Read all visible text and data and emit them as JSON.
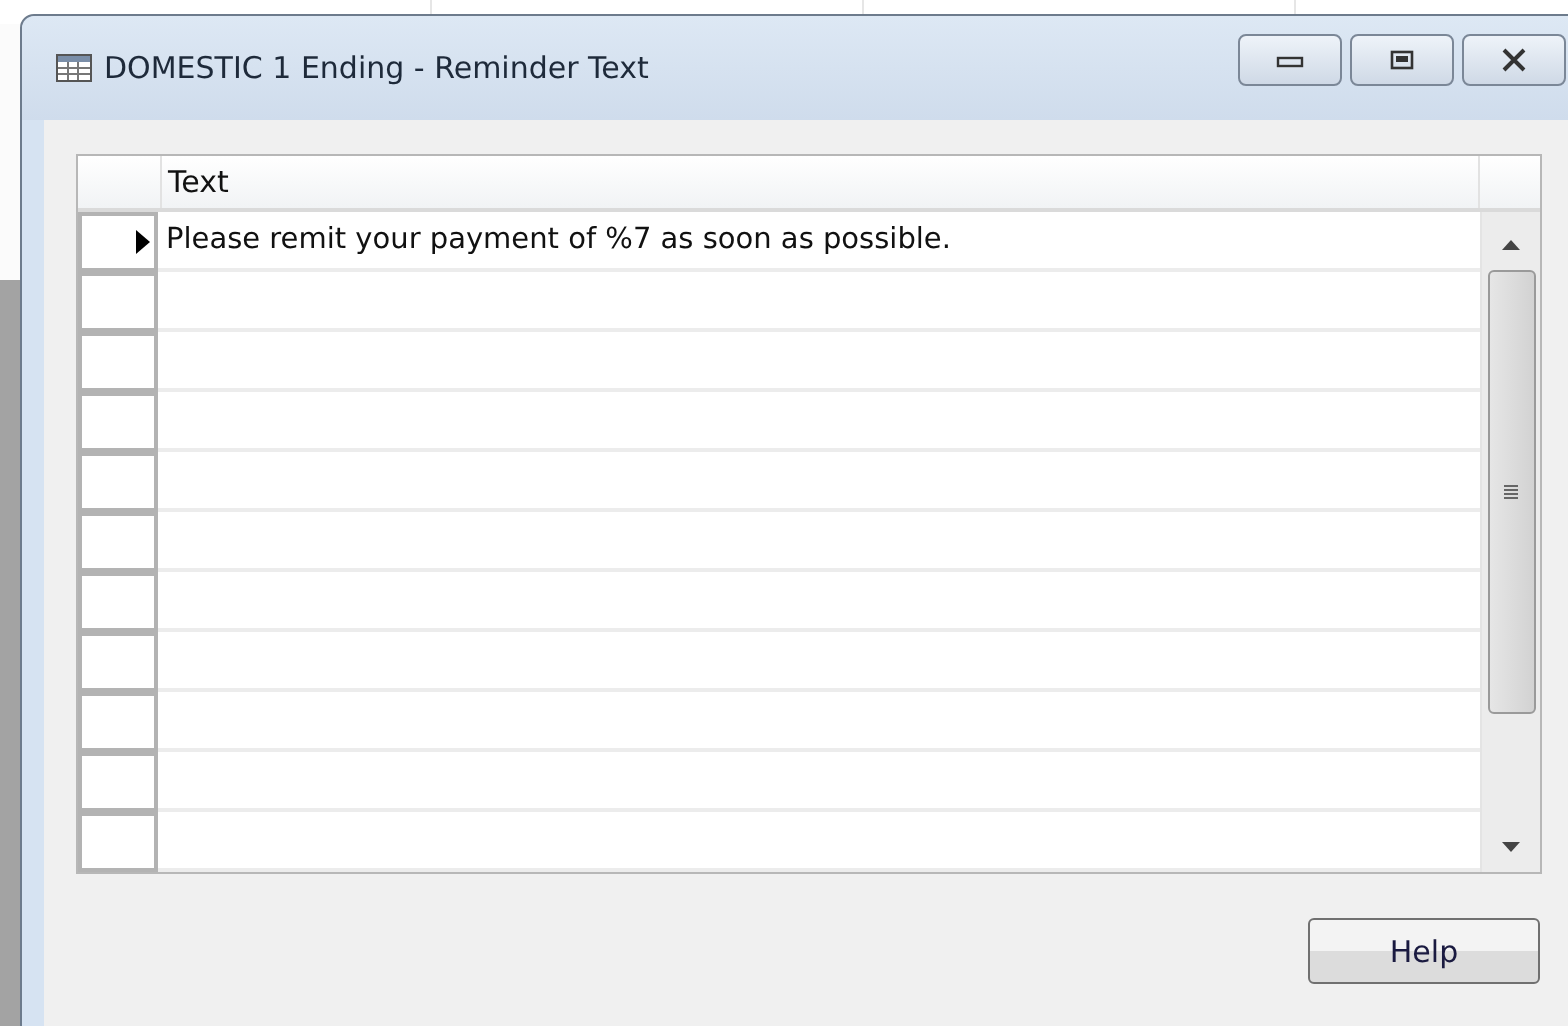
{
  "window": {
    "title": "DOMESTIC 1 Ending - Reminder Text"
  },
  "table": {
    "columns": [
      "Text"
    ],
    "rows": [
      {
        "text": "Please remit your payment of %7 as soon as possible.",
        "selected": true
      },
      {
        "selected": false
      },
      {
        "selected": false
      },
      {
        "selected": false
      },
      {
        "selected": false
      },
      {
        "selected": false
      },
      {
        "selected": false
      },
      {
        "selected": false
      },
      {
        "selected": false
      },
      {
        "selected": false
      },
      {
        "selected": false
      }
    ]
  },
  "buttons": [
    "Help"
  ]
}
